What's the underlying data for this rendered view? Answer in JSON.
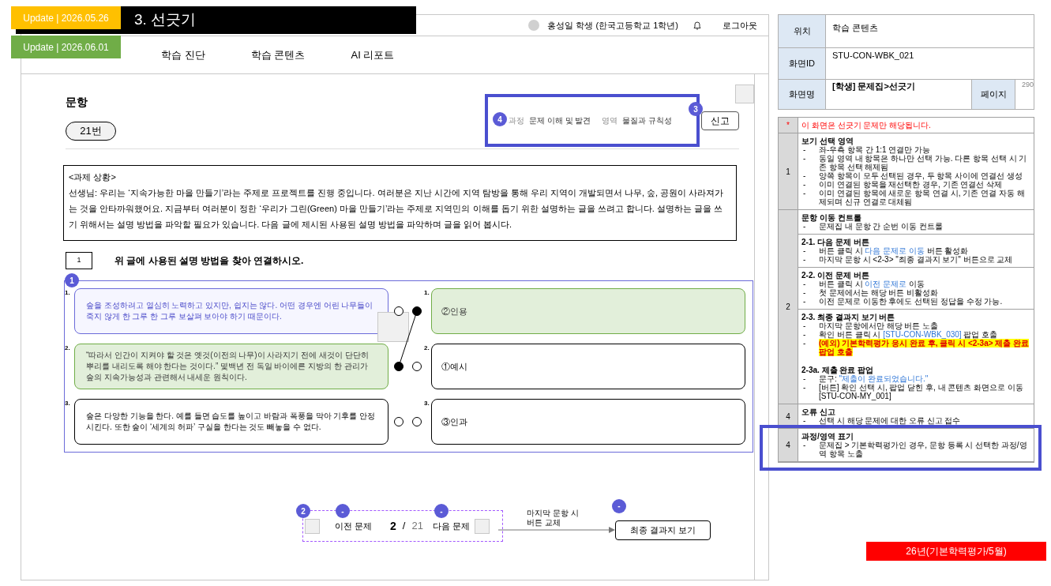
{
  "update_badges": [
    {
      "text": "Update | 2026.05.26",
      "color": "#ffc000"
    },
    {
      "text": "Update | 2026.06.01",
      "color": "#70ad47"
    }
  ],
  "screen_title": "3. 선긋기",
  "header": {
    "user": "홍성일 학생 (한국고등학교 1학년)",
    "logout": "로그아웃"
  },
  "nav": [
    "학습 진단",
    "학습 콘텐츠",
    "AI 리포트"
  ],
  "question_header": {
    "title": "문항",
    "number": "21번",
    "marker": "4",
    "report_marker": "3",
    "report_button": "신고",
    "tags": [
      {
        "label": "과정",
        "value": "문제 이해 및 발견"
      },
      {
        "label": "영역",
        "value": "물질과 규칙성"
      }
    ]
  },
  "passage": {
    "heading": "<과제 상황>",
    "body": "선생님: 우리는 ‘지속가능한 마을 만들기’라는 주제로 프로젝트를 진행 중입니다. 여러분은 지난 시간에 지역 탐방을 통해 우리 지역이 개발되면서 나무, 숲, 공원이 사라져가는 것을 안타까워했어요. 지금부터 여러분이 정한 ‘우리가 그린(Green) 마을 만들기’라는 주제로 지역민의 이해를 돕기 위한 설명하는 글을 쓰려고 합니다. 설명하는 글을 쓰기 위해서는 설명 방법을 파악할 필요가 있습니다. 다음 글에 제시된 사용된 설명 방법을 파악하며 글을 읽어 봅시다."
  },
  "prompt": {
    "number": "1",
    "text": "위 글에 사용된 설명 방법을 찾아 연결하시오."
  },
  "matching": {
    "marker": "1",
    "left": [
      {
        "index": "1.",
        "text": "숲을 조성하려고 열심히 노력하고 있지만, 쉽지는 않다. 어떤 경우엔 어린 나무들이 죽지 않게 한 그루 한 그루 보살펴 보아야 하기 때문이다.",
        "selected": true,
        "connected": false
      },
      {
        "index": "2.",
        "text": "“따라서 인간이 지켜야 할 것은 옛것(이전의 나무)이 사라지기 전에 새것이 단단히 뿌리를 내리도록 해야 한다는 것이다.” 몇백년 전 독일 바이에른 지방의 한 관리가 숲의 지속가능성과 관련해서 내세운 원칙이다.",
        "selected": false,
        "connected": true
      },
      {
        "index": "3.",
        "text": "숲은 다양한 기능을 한다. 예를 들면 습도를 높이고 바람과 폭풍을 막아 기후를 안정시킨다. 또한 숲이 ‘세계의 허파’ 구실을 한다는 것도 빼놓을 수 없다.",
        "selected": false,
        "connected": false
      }
    ],
    "right": [
      {
        "index": "1.",
        "text": "②인용",
        "connected": true
      },
      {
        "index": "2.",
        "text": "①예시",
        "connected": false
      },
      {
        "index": "3.",
        "text": "③인과",
        "connected": false
      }
    ]
  },
  "pager": {
    "marker": "2",
    "prev_marker": "-",
    "next_marker": "-",
    "final_marker": "-",
    "prev": "이전 문제",
    "current": "2",
    "separator": "/",
    "total": "21",
    "next": "다음 문제",
    "note": "마지막 문항 시 버튼 교체",
    "final_button": "최종 결과지 보기"
  },
  "spec": {
    "location_label": "위치",
    "location": "학습 콘텐츠",
    "id_label": "화면ID",
    "id": "STU-CON-WBK_021",
    "name_label": "화면명",
    "name": "[학생] 문제집>선긋기",
    "page_label": "페이지",
    "page": "290"
  },
  "description": [
    {
      "num": "*",
      "cells": [
        [
          {
            "kind": "alert",
            "parts": [
              {
                "text": "이 화면은 선긋기 문제만 해당됩니다.",
                "kind": "red"
              }
            ]
          }
        ]
      ]
    },
    {
      "num": "1",
      "cells": [
        [
          {
            "kind": "heading",
            "parts": [
              {
                "text": "보기 선택 영역",
                "kind": "plain"
              }
            ]
          },
          {
            "kind": "bullet",
            "marker": "-",
            "parts": [
              {
                "text": "좌-우측 항목 간 1:1 연결만 가능",
                "kind": "plain"
              }
            ]
          },
          {
            "kind": "bullet",
            "marker": "-",
            "parts": [
              {
                "text": "동일 영역 내 항목은 하나만 선택 가능. 다른 항목 선택 시 기존 항목 선택 해제됨",
                "kind": "plain"
              }
            ]
          },
          {
            "kind": "bullet",
            "marker": "-",
            "parts": [
              {
                "text": "양쪽 항목이 모두 선택된 경우, 두 항목 사이에 연결선 생성",
                "kind": "plain"
              }
            ]
          },
          {
            "kind": "bullet",
            "marker": "-",
            "parts": [
              {
                "text": "이미 연결된 항목을 재선택한 경우, 기존 연결선 삭제",
                "kind": "plain"
              }
            ]
          },
          {
            "kind": "bullet",
            "marker": "-",
            "parts": [
              {
                "text": "이미 연결된 항목에 새로운 항목 연결 시, 기존 연결 자동 해제되며 신규 연결로 대체됨",
                "kind": "plain"
              }
            ]
          }
        ]
      ]
    },
    {
      "num": "2",
      "cells": [
        [
          {
            "kind": "heading",
            "parts": [
              {
                "text": "문항 이동 컨트롤",
                "kind": "plain"
              }
            ]
          },
          {
            "kind": "bullet",
            "marker": "-",
            "parts": [
              {
                "text": "문제집 내 문항 간 순번 이동 컨트롤",
                "kind": "plain"
              }
            ]
          }
        ],
        [
          {
            "kind": "heading",
            "parts": [
              {
                "text": "2-1. 다음 문제 버튼",
                "kind": "plain"
              }
            ]
          },
          {
            "kind": "bullet",
            "marker": "-",
            "parts": [
              {
                "text": "버튼 클릭 시 ",
                "kind": "plain"
              },
              {
                "text": "다음 문제로 이동",
                "kind": "blue"
              },
              {
                "text": " 버튼 활성화",
                "kind": "plain"
              }
            ]
          },
          {
            "kind": "bullet",
            "marker": "-",
            "parts": [
              {
                "text": "마지막 문항 시 <2-3>  \"최종 결과지 보기\" 버튼으로 교체",
                "kind": "plain"
              }
            ]
          }
        ],
        [
          {
            "kind": "heading",
            "parts": [
              {
                "text": "2-2. 이전 문제 버튼",
                "kind": "plain"
              }
            ]
          },
          {
            "kind": "bullet",
            "marker": "-",
            "parts": [
              {
                "text": "버튼 클릭 시 ",
                "kind": "plain"
              },
              {
                "text": "이전 문제로",
                "kind": "blue"
              },
              {
                "text": " 이동",
                "kind": "plain"
              }
            ]
          },
          {
            "kind": "bullet",
            "marker": "-",
            "parts": [
              {
                "text": "첫 문제에서는 해당 버튼 비활성화",
                "kind": "plain"
              }
            ]
          },
          {
            "kind": "bullet",
            "marker": "-",
            "parts": [
              {
                "text": "이전 문제로 이동한 후에도 선택된 정답을 수정 가능.",
                "kind": "plain"
              }
            ]
          }
        ],
        [
          {
            "kind": "heading",
            "parts": [
              {
                "text": "2-3. 최종 결과지 보기 버튼",
                "kind": "plain"
              }
            ]
          },
          {
            "kind": "bullet",
            "marker": "-",
            "parts": [
              {
                "text": "마지막 문항에서만 해당 버튼 노출",
                "kind": "plain"
              }
            ]
          },
          {
            "kind": "bullet",
            "marker": "-",
            "parts": [
              {
                "text": "확인 버튼 클릭 시 ",
                "kind": "plain"
              },
              {
                "text": "[STU-CON-WBK_030]",
                "kind": "blue"
              },
              {
                "text": " 팝업 호출",
                "kind": "plain"
              }
            ]
          },
          {
            "kind": "bullet",
            "marker": "-",
            "parts": [
              {
                "text": "(예외) 기본학력평가 응시 완료 후, 클릭 시 <2-3a> 제출 완료 팝업 호출",
                "kind": "highlight"
              }
            ]
          },
          {
            "kind": "subheading",
            "parts": [
              {
                "text": "2-3a. 제출 완료 팝업",
                "kind": "plain"
              }
            ]
          },
          {
            "kind": "bullet",
            "marker": "-",
            "parts": [
              {
                "text": "문구: ",
                "kind": "plain"
              },
              {
                "text": "\"제출이 완료되었습니다.\"",
                "kind": "blue"
              }
            ]
          },
          {
            "kind": "bullet",
            "marker": "-",
            "parts": [
              {
                "text": "[버튼] 확인 선택 시, 팝업 닫힌 후, 내 콘텐츠 화면으로 이동 [STU-CON-MY_001]",
                "kind": "plain"
              }
            ]
          }
        ]
      ]
    },
    {
      "num": "4",
      "cells": [
        [
          {
            "kind": "heading",
            "parts": [
              {
                "text": "오류 신고",
                "kind": "plain"
              }
            ]
          },
          {
            "kind": "bullet",
            "marker": "-",
            "parts": [
              {
                "text": "선택 시 해당 문제에 대한 오류 신고 접수",
                "kind": "plain"
              }
            ]
          }
        ]
      ]
    },
    {
      "num": "4",
      "cells": [
        [
          {
            "kind": "heading",
            "parts": [
              {
                "text": "과정/영역 표기",
                "kind": "plain"
              }
            ]
          },
          {
            "kind": "bullet",
            "marker": "-",
            "parts": [
              {
                "text": "문제집 > 기본학력평가인 경우, 문항 등록 시 선택한 과정/영역 항목 노출",
                "kind": "plain"
              }
            ]
          }
        ]
      ]
    }
  ],
  "footer_tag": "26년(기본학력평가/5월)"
}
